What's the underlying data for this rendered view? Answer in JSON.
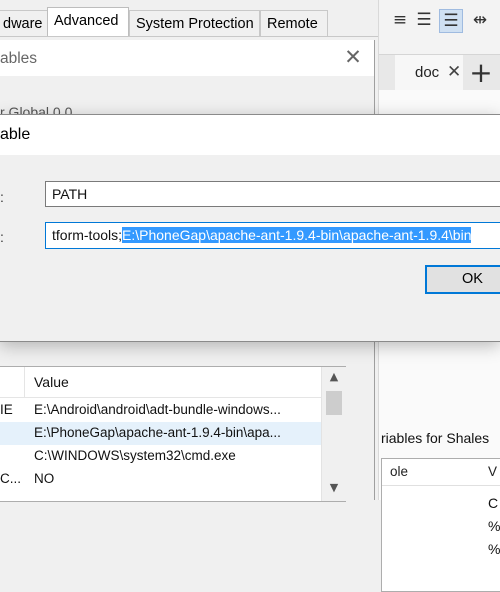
{
  "system_properties": {
    "tabs": [
      {
        "label": "dware"
      },
      {
        "label": "Advanced"
      },
      {
        "label": "System Protection"
      },
      {
        "label": "Remote"
      }
    ]
  },
  "env_vars_dialog": {
    "title": "ables",
    "partial_text": "r Global 0 0",
    "user_table": {
      "header": {
        "value": "Value"
      },
      "rows": [
        {
          "variable": "IE",
          "value": "E:\\Android\\android\\adt-bundle-windows..."
        },
        {
          "variable": "",
          "value": "E:\\PhoneGap\\apache-ant-1.9.4-bin\\apa..."
        },
        {
          "variable": "",
          "value": "C:\\WINDOWS\\system32\\cmd.exe"
        },
        {
          "variable": "C...",
          "value": "NO"
        }
      ]
    },
    "close_icon": "close-icon"
  },
  "edit_dialog": {
    "title": "able",
    "name_label": ":",
    "name_value": "PATH",
    "value_label": ":",
    "value_prefix": "tform-tools;",
    "value_selected": "E:\\PhoneGap\\apache-ant-1.9.4-bin\\apache-ant-1.9.4\\bin",
    "ok_label": "OK"
  },
  "right_window": {
    "toolbar_icons": [
      "align-right-icon",
      "justify-icon",
      "justify-columns-icon"
    ],
    "tab_label": "doc",
    "new_tab_icon": "plus-icon",
    "sys_vars_heading": "riables for Shales",
    "sys_table": {
      "headers": [
        "ole",
        "V"
      ],
      "rows": [
        {
          "col2": "C"
        },
        {
          "col2": "%"
        },
        {
          "col2": "%"
        }
      ]
    }
  },
  "colors": {
    "accent": "#0078d7",
    "selection": "#3399ff",
    "selected_row": "#e5f1fb"
  }
}
